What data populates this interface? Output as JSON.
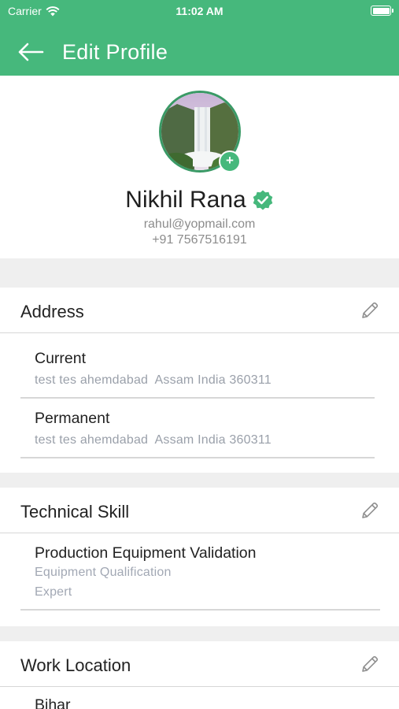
{
  "status_bar": {
    "carrier": "Carrier",
    "time": "11:02 AM"
  },
  "nav": {
    "title": "Edit Profile"
  },
  "profile": {
    "name": "Nikhil Rana",
    "email": "rahul@yopmail.com",
    "phone": "+91 7567516191",
    "add_photo_glyph": "+"
  },
  "address": {
    "title": "Address",
    "items": [
      {
        "label": "Current",
        "value": "test tes ahemdabad  Assam India 360311"
      },
      {
        "label": "Permanent",
        "value": "test tes ahemdabad  Assam India 360311"
      }
    ]
  },
  "technical_skill": {
    "title": "Technical Skill",
    "items": [
      {
        "name": "Production Equipment Validation",
        "category": "Equipment Qualification",
        "level": "Expert"
      }
    ]
  },
  "work_location": {
    "title": "Work Location",
    "items": [
      {
        "label": "Bihar"
      }
    ]
  },
  "colors": {
    "accent": "#46b87c",
    "muted_text": "#9aa0aa",
    "divider": "#d7d7d7",
    "section_gap": "#efefef"
  },
  "icons": [
    "wifi-icon",
    "battery-icon",
    "back-arrow-icon",
    "verified-badge-icon",
    "add-photo-icon",
    "pencil-icon"
  ]
}
